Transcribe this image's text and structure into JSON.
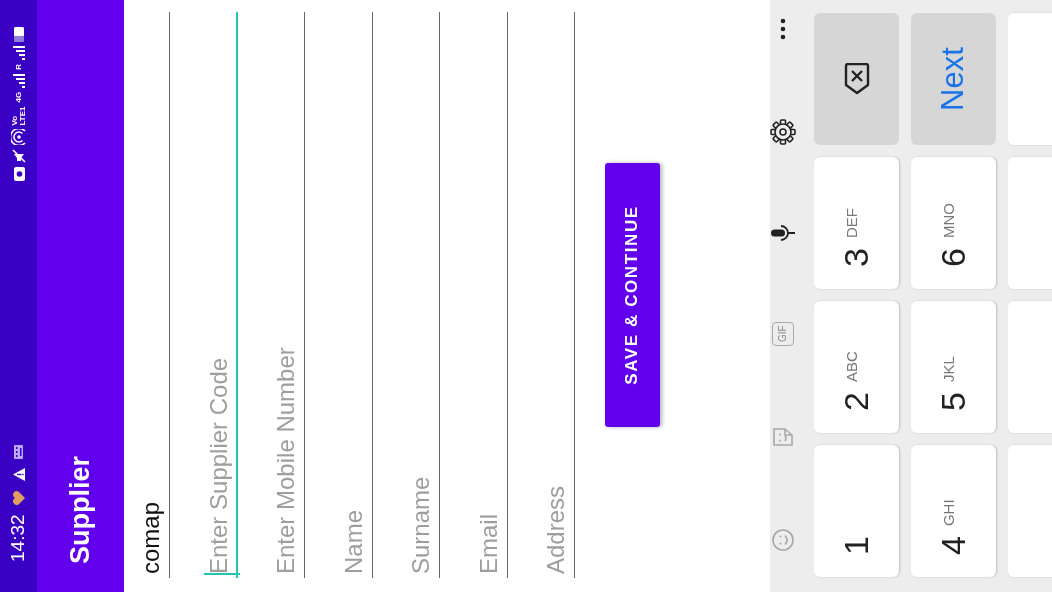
{
  "status_bar": {
    "time": "14:32",
    "volte": [
      "Vo",
      "LTE1"
    ],
    "network": "4G",
    "roaming": "R"
  },
  "app_bar": {
    "title": "Supplier"
  },
  "fields": [
    {
      "value": "comap",
      "focused": false
    },
    {
      "placeholder": "Enter Supplier Code",
      "focused": true
    },
    {
      "placeholder": "Enter Mobile Number",
      "focused": false
    },
    {
      "placeholder": "Name",
      "focused": false
    },
    {
      "placeholder": "Surname",
      "focused": false
    },
    {
      "placeholder": "Email",
      "focused": false
    },
    {
      "placeholder": "Address",
      "focused": false
    }
  ],
  "save_button": {
    "label": "SAVE & CONTINUE"
  },
  "keyboard": {
    "toolbar": [
      {
        "kind": "emoji",
        "disabled": true
      },
      {
        "kind": "sticker",
        "disabled": true
      },
      {
        "kind": "gif",
        "label": "GIF",
        "disabled": true
      },
      {
        "kind": "mic",
        "disabled": false
      },
      {
        "kind": "settings",
        "disabled": false
      },
      {
        "kind": "more",
        "disabled": false
      }
    ],
    "keys": [
      {
        "kind": "digit",
        "digit": "1"
      },
      {
        "kind": "digit",
        "digit": "2",
        "letters": "ABC"
      },
      {
        "kind": "digit",
        "digit": "3",
        "letters": "DEF"
      },
      {
        "kind": "backspace"
      },
      {
        "kind": "digit",
        "digit": "4",
        "letters": "GHI"
      },
      {
        "kind": "digit",
        "digit": "5",
        "letters": "JKL"
      },
      {
        "kind": "digit",
        "digit": "6",
        "letters": "MNO"
      },
      {
        "kind": "action",
        "label": "Next"
      },
      {
        "kind": "blank"
      },
      {
        "kind": "blank"
      },
      {
        "kind": "blank"
      },
      {
        "kind": "blank"
      }
    ]
  }
}
